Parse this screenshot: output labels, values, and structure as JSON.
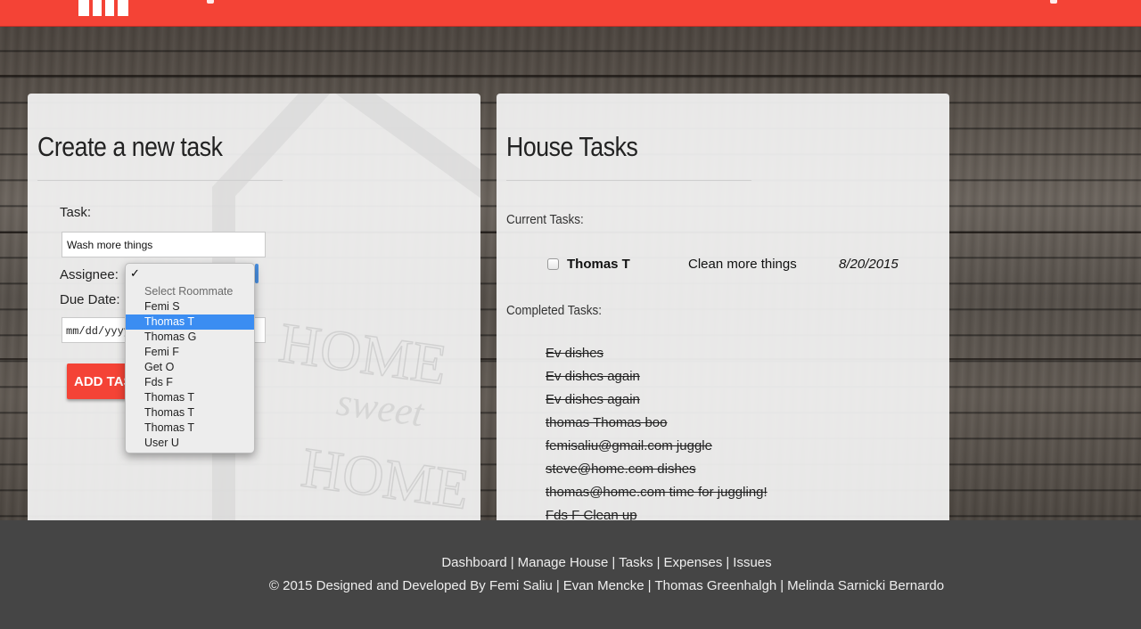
{
  "app": {
    "logo_icon": "house-logo-icon",
    "accent_color": "#f44336"
  },
  "create_task": {
    "heading": "Create a new task",
    "task_label": "Task:",
    "task_value": "Wash more things",
    "assignee_label": "Assignee:",
    "due_date_label": "Due Date:",
    "due_date_placeholder": "mm/dd/yyyy",
    "add_button": "ADD TASK",
    "assignee_options": {
      "checkmark": "✓",
      "placeholder": "Select Roommate",
      "items": [
        "Femi S",
        "Thomas T",
        "Thomas G",
        "Femi F",
        "Get O",
        "Fds F",
        "Thomas T",
        "Thomas T",
        "Thomas T",
        "User U"
      ],
      "selected_index": 1
    }
  },
  "house_tasks": {
    "heading": "House Tasks",
    "current_label": "Current Tasks:",
    "current": [
      {
        "assignee": "Thomas T",
        "task": "Clean more things",
        "due": "8/20/2015",
        "done": false
      }
    ],
    "completed_label": "Completed Tasks:",
    "completed": [
      "Ev dishes",
      "Ev dishes again",
      "Ev dishes again",
      "thomas Thomas boo",
      "femisaliu@gmail.com juggle",
      "steve@home.com dishes",
      "thomas@home.com time for juggling!",
      "Fds F Clean up"
    ]
  },
  "watermark": {
    "line1": "HOME",
    "line2": "sweet",
    "line3": "HOME"
  },
  "footer": {
    "nav": [
      "Dashboard",
      "Manage House",
      "Tasks",
      "Expenses",
      "Issues"
    ],
    "copyright": "© 2015 Designed and Developed By",
    "authors": [
      "Femi Saliu",
      "Evan Mencke",
      "Thomas Greenhalgh",
      "Melinda Sarnicki Bernardo"
    ]
  }
}
